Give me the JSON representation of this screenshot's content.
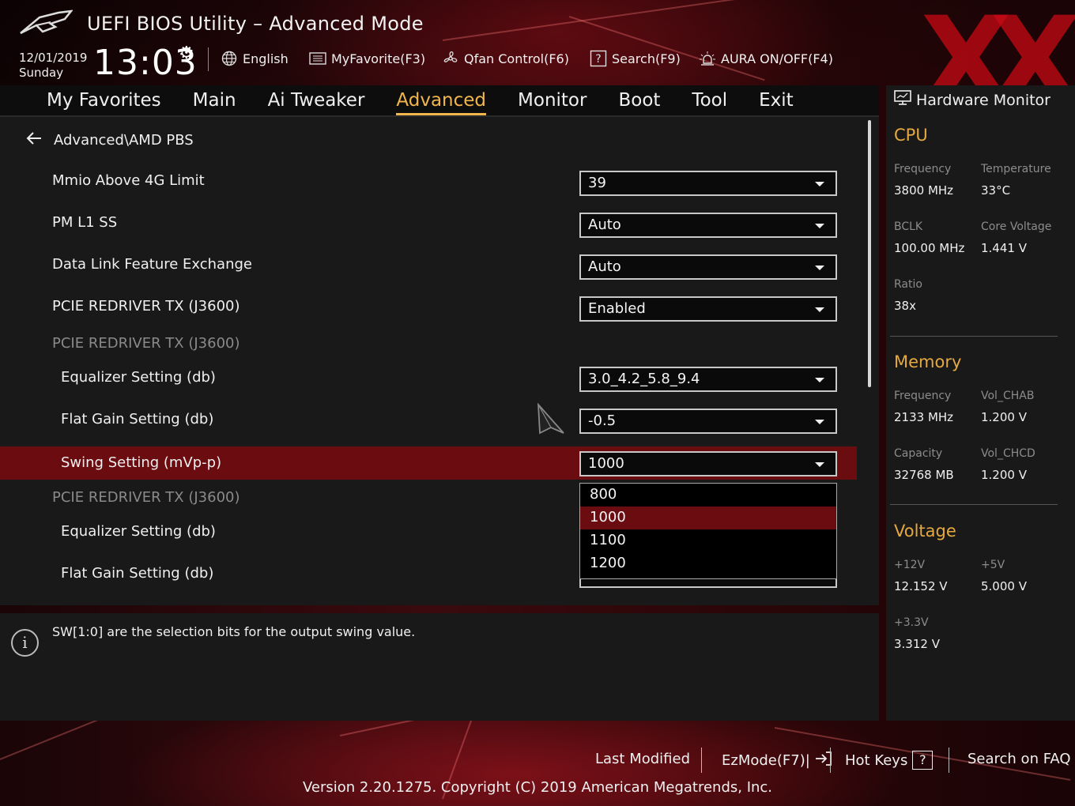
{
  "header": {
    "title": "UEFI BIOS Utility – Advanced Mode",
    "date": "12/01/2019",
    "day": "Sunday",
    "time": "13:03",
    "language": "English",
    "myfavorite": "MyFavorite(F3)",
    "qfan": "Qfan Control(F6)",
    "search": "Search(F9)",
    "aura": "AURA ON/OFF(F4)"
  },
  "tabs": [
    "My Favorites",
    "Main",
    "Ai Tweaker",
    "Advanced",
    "Monitor",
    "Boot",
    "Tool",
    "Exit"
  ],
  "active_tab": "Advanced",
  "breadcrumb": "Advanced\\AMD PBS",
  "settings": [
    {
      "label": "Mmio Above 4G Limit",
      "value": "39"
    },
    {
      "label": "PM L1 SS",
      "value": "Auto"
    },
    {
      "label": "Data Link Feature Exchange",
      "value": "Auto"
    },
    {
      "label": "PCIE REDRIVER TX (J3600)",
      "value": "Enabled"
    },
    {
      "label": "PCIE REDRIVER TX (J3600)"
    },
    {
      "label": "Equalizer Setting (db)",
      "value": "3.0_4.2_5.8_9.4"
    },
    {
      "label": "Flat Gain Setting (db)",
      "value": "-0.5"
    },
    {
      "label": "Swing Setting (mVp-p)",
      "value": "1000"
    },
    {
      "label": "PCIE REDRIVER TX (J3600)"
    },
    {
      "label": "Equalizer Setting (db)"
    },
    {
      "label": "Flat Gain Setting (db)"
    }
  ],
  "dropdown_options": [
    "800",
    "1000",
    "1100",
    "1200"
  ],
  "dropdown_selected": "1000",
  "info_text": "SW[1:0] are the selection bits for the output swing value.",
  "hw_monitor": {
    "title": "Hardware Monitor",
    "cpu": {
      "heading": "CPU",
      "frequency_label": "Frequency",
      "frequency": "3800 MHz",
      "temperature_label": "Temperature",
      "temperature": "33°C",
      "bclk_label": "BCLK",
      "bclk": "100.00 MHz",
      "core_voltage_label": "Core Voltage",
      "core_voltage": "1.441 V",
      "ratio_label": "Ratio",
      "ratio": "38x"
    },
    "memory": {
      "heading": "Memory",
      "frequency_label": "Frequency",
      "frequency": "2133 MHz",
      "vol_chab_label": "Vol_CHAB",
      "vol_chab": "1.200 V",
      "capacity_label": "Capacity",
      "capacity": "32768 MB",
      "vol_chcd_label": "Vol_CHCD",
      "vol_chcd": "1.200 V"
    },
    "voltage": {
      "heading": "Voltage",
      "v12_label": "+12V",
      "v12": "12.152 V",
      "v5_label": "+5V",
      "v5": "5.000 V",
      "v33_label": "+3.3V",
      "v33": "3.312 V"
    }
  },
  "footer": {
    "last_modified": "Last Modified",
    "ezmode": "EzMode(F7)|",
    "hotkeys": "Hot Keys",
    "hotkeys_key": "?",
    "search_faq": "Search on FAQ",
    "version": "Version 2.20.1275. Copyright (C) 2019 American Megatrends, Inc."
  },
  "colors": {
    "accent": "#f1b64c",
    "selected_row": "#6b0c10",
    "panel": "#191919"
  }
}
